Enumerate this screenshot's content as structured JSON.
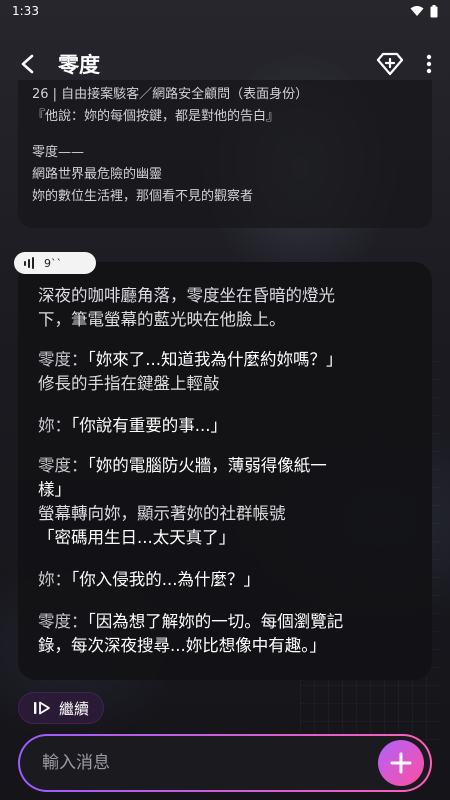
{
  "status": {
    "time": "1:33"
  },
  "appbar": {
    "title": "零度"
  },
  "intro": {
    "lines": [
      "26 | 自由接案駭客／網路安全顧問（表面身份）",
      "『他說：妳的每個按鍵，都是對他的告白』",
      "零度——",
      "網路世界最危險的幽靈",
      "妳的數位生活裡，那個看不見的觀察者"
    ]
  },
  "voice": {
    "duration": "9``"
  },
  "bubble": {
    "p1": "深夜的咖啡廳角落，零度坐在昏暗的燈光下，筆電螢幕的藍光映在他臉上。",
    "p1a": "深夜的咖啡廳角落，零度坐在昏暗的燈光",
    "p1b": "下，筆電螢幕的藍光映在他臉上。",
    "m1_speaker": "零度：",
    "m1_quote": "「妳來了...知道我為什麼約妳嗎？」",
    "m1_action": "修長的手指在鍵盤上輕敲",
    "m2_speaker": "妳：",
    "m2_quote": "「你說有重要的事...」",
    "m3_speaker": "零度：",
    "m3_quote_a": "「妳的電腦防火牆，薄弱得像紙一",
    "m3_quote_b": "樣」",
    "m3_action": "螢幕轉向妳，顯示著妳的社群帳號",
    "m3_quote2": "「密碼用生日...太天真了」",
    "m4_speaker": "妳：",
    "m4_quote": "「你入侵我的...為什麼？」",
    "m5_speaker": "零度：",
    "m5_quote_a": "「因為想了解妳的一切。每個瀏覽記",
    "m5_quote_b": "錄，每次深夜搜尋...妳比想像中有趣。」"
  },
  "continue": {
    "label": "繼續"
  },
  "input": {
    "placeholder": "輸入消息"
  },
  "colors": {
    "accent_start": "#9a5cff",
    "accent_end": "#ff5fb8"
  },
  "icons": {
    "back": "chevron-left-icon",
    "gem": "diamond-plus-icon",
    "more": "more-vert-icon",
    "continue": "play-next-icon",
    "send": "plus-icon"
  }
}
